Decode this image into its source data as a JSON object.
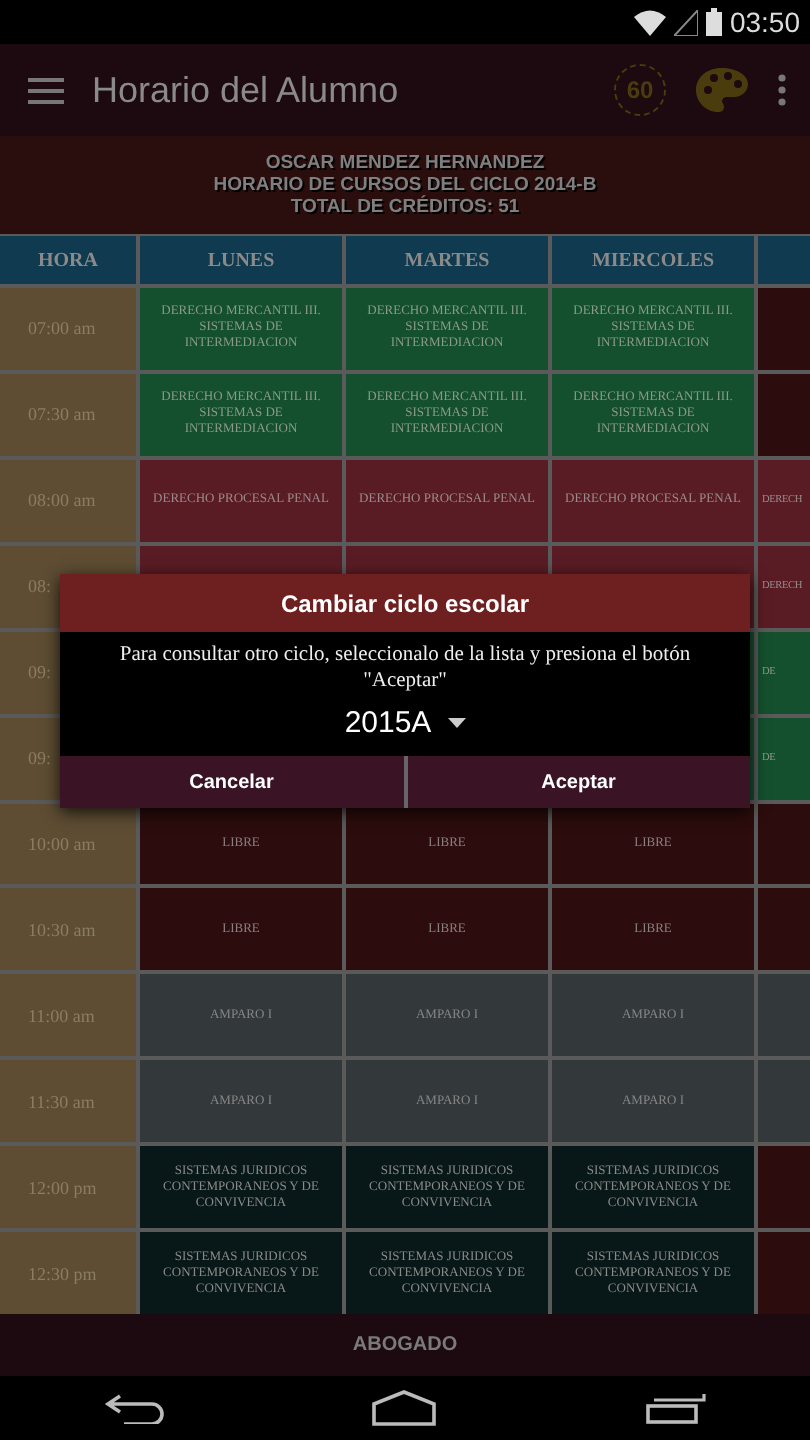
{
  "status_bar": {
    "time": "03:50"
  },
  "app_bar": {
    "title": "Horario del Alumno",
    "badge_text": "60"
  },
  "info": {
    "student": "OSCAR MENDEZ HERNANDEZ",
    "cycle": "HORARIO DE CURSOS DEL CICLO 2014-B",
    "credits": "TOTAL DE CRÉDITOS: 51"
  },
  "table": {
    "columns": [
      "HORA",
      "LUNES",
      "MARTES",
      "MIERCOLES",
      ""
    ],
    "rows": [
      {
        "cells": [
          {
            "kind": "time",
            "text": "07:00 am"
          },
          {
            "kind": "mercantil",
            "text": "DERECHO MERCANTIL III. SISTEMAS DE INTERMEDIACION"
          },
          {
            "kind": "mercantil",
            "text": "DERECHO MERCANTIL III. SISTEMAS DE INTERMEDIACION"
          },
          {
            "kind": "mercantil",
            "text": "DERECHO MERCANTIL III. SISTEMAS DE INTERMEDIACION"
          },
          {
            "kind": "libre"
          }
        ]
      },
      {
        "cells": [
          {
            "kind": "time",
            "text": "07:30 am"
          },
          {
            "kind": "mercantil",
            "text": "DERECHO MERCANTIL III. SISTEMAS DE INTERMEDIACION"
          },
          {
            "kind": "mercantil",
            "text": "DERECHO MERCANTIL III. SISTEMAS DE INTERMEDIACION"
          },
          {
            "kind": "mercantil",
            "text": "DERECHO MERCANTIL III. SISTEMAS DE INTERMEDIACION"
          },
          {
            "kind": "libre"
          }
        ]
      },
      {
        "cells": [
          {
            "kind": "time",
            "text": "08:00 am"
          },
          {
            "kind": "penal",
            "text": "DERECHO PROCESAL PENAL"
          },
          {
            "kind": "penal",
            "text": "DERECHO PROCESAL PENAL"
          },
          {
            "kind": "penal",
            "text": "DERECHO PROCESAL PENAL"
          },
          {
            "kind": "penal",
            "text": "DERECH"
          }
        ]
      },
      {
        "cells": [
          {
            "kind": "time",
            "text": "08:"
          },
          {
            "kind": "penal"
          },
          {
            "kind": "penal"
          },
          {
            "kind": "penal"
          },
          {
            "kind": "penal",
            "text": "DERECH"
          }
        ]
      },
      {
        "cells": [
          {
            "kind": "time",
            "text": "09:"
          },
          {
            "kind": "covered"
          },
          {
            "kind": "covered"
          },
          {
            "kind": "covered"
          },
          {
            "kind": "mercantil",
            "text": "DE"
          }
        ]
      },
      {
        "cells": [
          {
            "kind": "time",
            "text": "09:"
          },
          {
            "kind": "covered"
          },
          {
            "kind": "covered"
          },
          {
            "kind": "covered"
          },
          {
            "kind": "mercantil",
            "text": "DE"
          }
        ]
      },
      {
        "cells": [
          {
            "kind": "time",
            "text": "10:00 am"
          },
          {
            "kind": "libre",
            "text": "LIBRE"
          },
          {
            "kind": "libre",
            "text": "LIBRE"
          },
          {
            "kind": "libre",
            "text": "LIBRE"
          },
          {
            "kind": "libre"
          }
        ]
      },
      {
        "cells": [
          {
            "kind": "time",
            "text": "10:30 am"
          },
          {
            "kind": "libre",
            "text": "LIBRE"
          },
          {
            "kind": "libre",
            "text": "LIBRE"
          },
          {
            "kind": "libre",
            "text": "LIBRE"
          },
          {
            "kind": "libre"
          }
        ]
      },
      {
        "cells": [
          {
            "kind": "time",
            "text": "11:00 am"
          },
          {
            "kind": "amparo",
            "text": "AMPARO I"
          },
          {
            "kind": "amparo",
            "text": "AMPARO I"
          },
          {
            "kind": "amparo",
            "text": "AMPARO I"
          },
          {
            "kind": "amparo"
          }
        ]
      },
      {
        "cells": [
          {
            "kind": "time",
            "text": "11:30 am"
          },
          {
            "kind": "amparo",
            "text": "AMPARO I"
          },
          {
            "kind": "amparo",
            "text": "AMPARO I"
          },
          {
            "kind": "amparo",
            "text": "AMPARO I"
          },
          {
            "kind": "amparo"
          }
        ]
      },
      {
        "cells": [
          {
            "kind": "time",
            "text": "12:00 pm"
          },
          {
            "kind": "sistemas",
            "text": "SISTEMAS JURIDICOS CONTEMPORANEOS Y DE CONVIVENCIA"
          },
          {
            "kind": "sistemas",
            "text": "SISTEMAS JURIDICOS CONTEMPORANEOS Y DE CONVIVENCIA"
          },
          {
            "kind": "sistemas",
            "text": "SISTEMAS JURIDICOS CONTEMPORANEOS Y DE CONVIVENCIA"
          },
          {
            "kind": "libre"
          }
        ]
      },
      {
        "cells": [
          {
            "kind": "time",
            "text": "12:30 pm"
          },
          {
            "kind": "sistemas",
            "text": "SISTEMAS JURIDICOS CONTEMPORANEOS Y DE CONVIVENCIA"
          },
          {
            "kind": "sistemas",
            "text": "SISTEMAS JURIDICOS CONTEMPORANEOS Y DE CONVIVENCIA"
          },
          {
            "kind": "sistemas",
            "text": "SISTEMAS JURIDICOS CONTEMPORANEOS Y DE CONVIVENCIA"
          },
          {
            "kind": "libre"
          }
        ]
      }
    ]
  },
  "footer": "ABOGADO",
  "dialog": {
    "title": "Cambiar ciclo escolar",
    "message": "Para consultar otro ciclo, seleccionalo de la lista y presiona el botón \"Aceptar\"",
    "spinner_value": "2015A",
    "buttons": [
      "Cancelar",
      "Aceptar"
    ]
  }
}
